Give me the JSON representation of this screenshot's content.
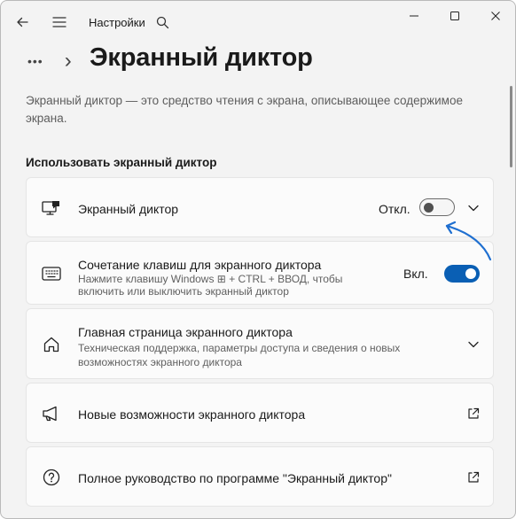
{
  "titlebar": {
    "app_title": "Настройки",
    "back_icon": "back-arrow-icon",
    "menu_icon": "hamburger-menu-icon",
    "search_icon": "search-icon",
    "window_controls": [
      "minimize-icon",
      "maximize-icon",
      "close-icon"
    ]
  },
  "header": {
    "breadcrumb_more": "•••",
    "breadcrumb_separator": "›",
    "page_title": "Экранный диктор"
  },
  "description": "Экранный диктор — это средство чтения с экрана, описывающее содержимое экрана.",
  "section": {
    "title": "Использовать экранный диктор"
  },
  "cards": {
    "narrator": {
      "title": "Экранный диктор",
      "state_label": "Откл.",
      "toggle_on": false,
      "icon": "narrator-monitor-icon",
      "expand_icon": "chevron-down-icon"
    },
    "shortcut": {
      "title": "Сочетание клавиш для экранного диктора",
      "subtitle_line1": "Нажмите клавишу Windows ⊞ + CTRL + ВВОД, чтобы",
      "subtitle_line2": "включить или выключить экранный диктор",
      "state_label": "Вкл.",
      "toggle_on": true,
      "icon": "keyboard-icon"
    },
    "home": {
      "title": "Главная страница экранного диктора",
      "subtitle_line1": "Техническая поддержка, параметры доступа и сведения о новых",
      "subtitle_line2": "возможностях экранного диктора",
      "icon": "home-icon",
      "expand_icon": "chevron-down-icon"
    },
    "whats_new": {
      "title": "Новые возможности экранного диктора",
      "icon": "megaphone-icon",
      "link_icon": "external-link-icon"
    },
    "guide": {
      "title": "Полное руководство по программе \"Экранный диктор\"",
      "icon": "help-circle-icon",
      "link_icon": "external-link-icon"
    }
  },
  "colors": {
    "accent": "#0a5fb4",
    "annotation_arrow": "#1f6fd0",
    "window_bg": "#f3f3f3",
    "card_bg": "#fbfbfb"
  }
}
